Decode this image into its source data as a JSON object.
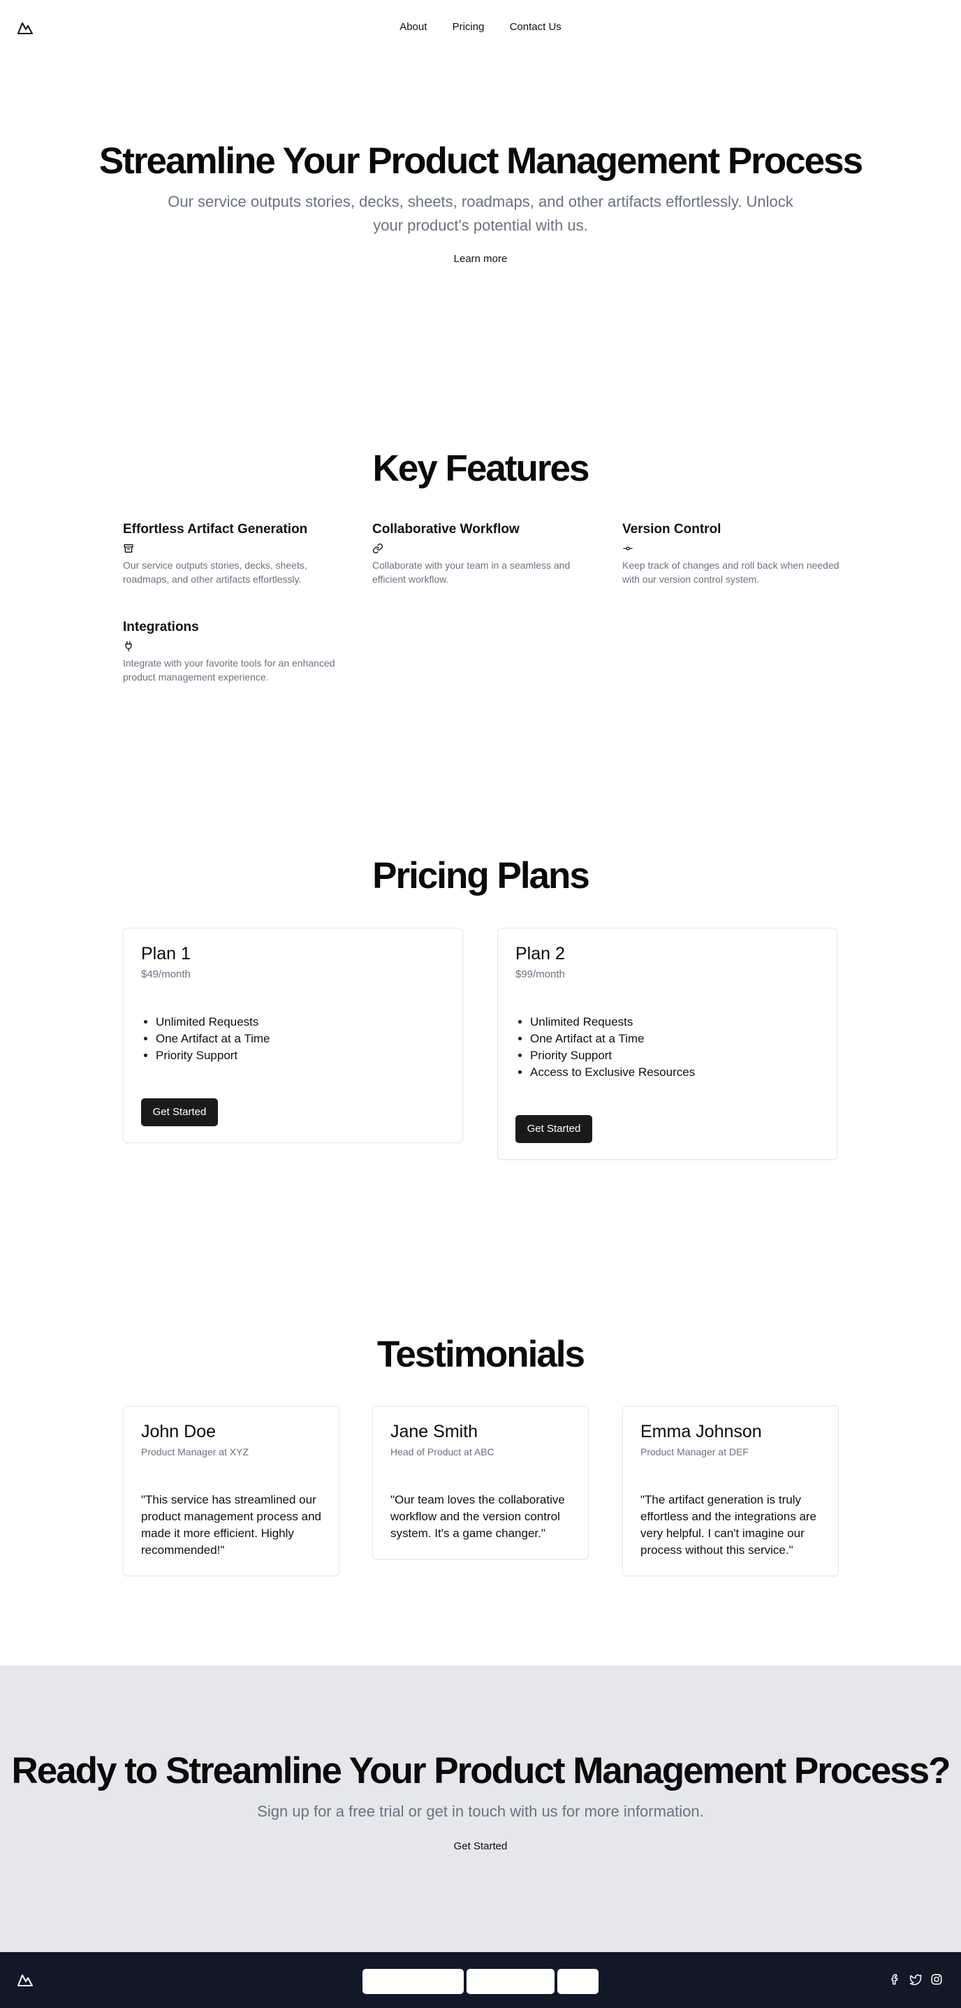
{
  "header": {
    "logo_icon": "mountain-icon",
    "nav": [
      {
        "label": "About"
      },
      {
        "label": "Pricing"
      },
      {
        "label": "Contact Us"
      }
    ]
  },
  "hero": {
    "title": "Streamline Your Product Management Process",
    "subtitle": "Our service outputs stories, decks, sheets, roadmaps, and other artifacts effortlessly. Unlock your product's potential with us.",
    "link_label": "Learn more"
  },
  "features": {
    "title": "Key Features",
    "items": [
      {
        "title": "Effortless Artifact Generation",
        "icon": "archive-icon",
        "description": "Our service outputs stories, decks, sheets, roadmaps, and other artifacts effortlessly."
      },
      {
        "title": "Collaborative Workflow",
        "icon": "link-icon",
        "description": "Collaborate with your team in a seamless and efficient workflow."
      },
      {
        "title": "Version Control",
        "icon": "git-commit-icon",
        "description": "Keep track of changes and roll back when needed with our version control system."
      },
      {
        "title": "Integrations",
        "icon": "plug-icon",
        "description": "Integrate with your favorite tools for an enhanced product management experience."
      }
    ]
  },
  "pricing": {
    "title": "Pricing Plans",
    "plans": [
      {
        "name": "Plan 1",
        "price": "$49/month",
        "features": [
          "Unlimited Requests",
          "One Artifact at a Time",
          "Priority Support"
        ],
        "button_label": "Get Started"
      },
      {
        "name": "Plan 2",
        "price": "$99/month",
        "features": [
          "Unlimited Requests",
          "One Artifact at a Time",
          "Priority Support",
          "Access to Exclusive Resources"
        ],
        "button_label": "Get Started"
      }
    ]
  },
  "testimonials": {
    "title": "Testimonials",
    "items": [
      {
        "name": "John Doe",
        "role": "Product Manager at XYZ",
        "quote": "\"This service has streamlined our product management process and made it more efficient. Highly recommended!\""
      },
      {
        "name": "Jane Smith",
        "role": "Head of Product at ABC",
        "quote": "\"Our team loves the collaborative workflow and the version control system. It's a game changer.\""
      },
      {
        "name": "Emma Johnson",
        "role": "Product Manager at DEF",
        "quote": "\"The artifact generation is truly effortless and the integrations are very helpful. I can't imagine our process without this service.\""
      }
    ]
  },
  "cta": {
    "title": "Ready to Streamline Your Product Management Process?",
    "subtitle": "Sign up for a free trial or get in touch with us for more information.",
    "link_label": "Get Started"
  },
  "footer": {
    "logo_icon": "mountain-icon",
    "social_icons": [
      "facebook-icon",
      "twitter-icon",
      "instagram-icon"
    ]
  },
  "colors": {
    "button_bg": "#1a1a1a",
    "muted_text": "#6b7280",
    "cta_bg": "#e5e7eb",
    "footer_bg": "#111827"
  }
}
